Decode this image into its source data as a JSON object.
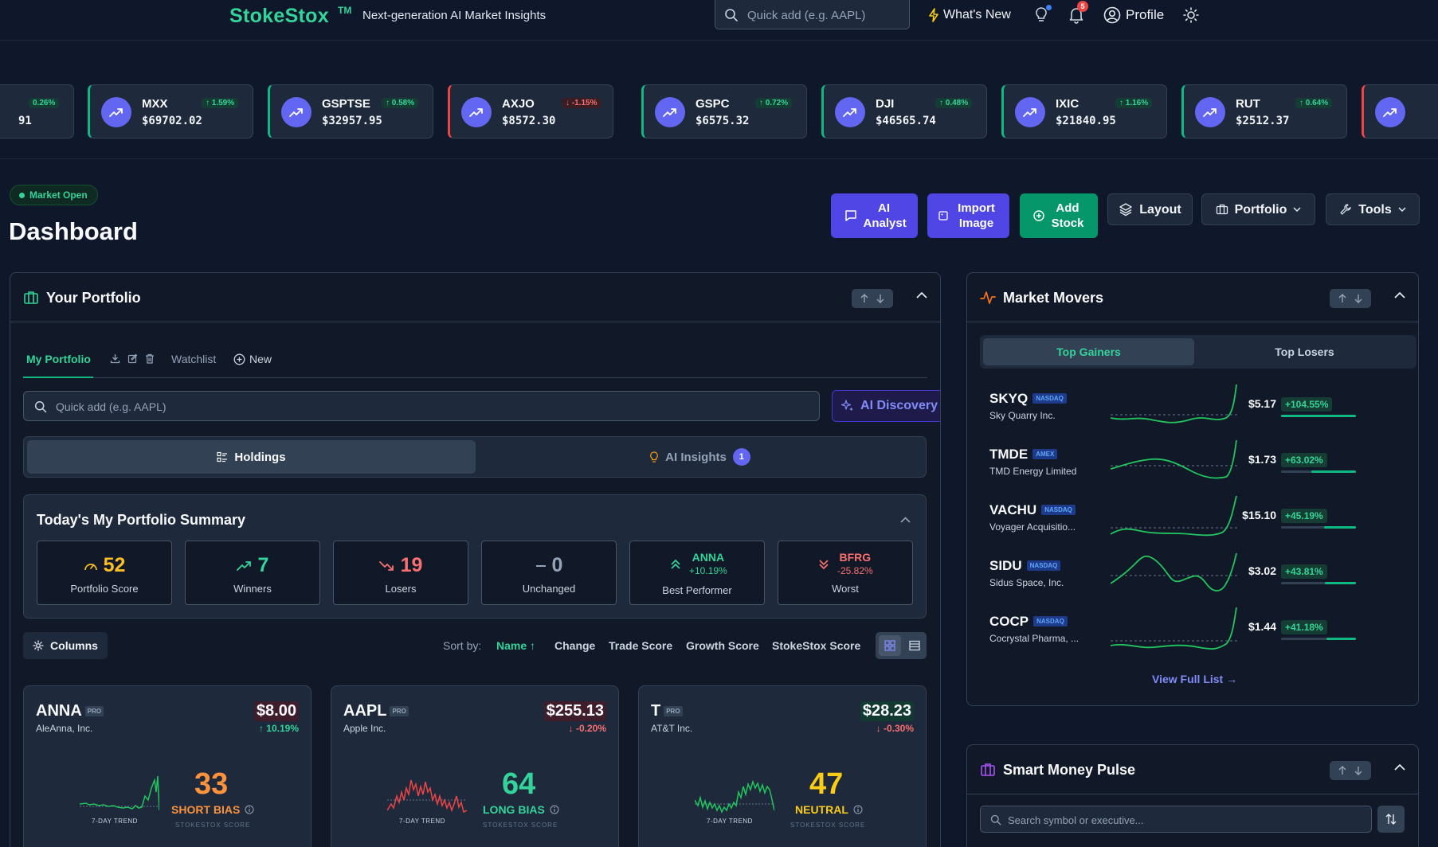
{
  "colors": {
    "accent_green": "#34d399",
    "indigo": "#4f46e5",
    "danger": "#f87171",
    "orange": "#fb923c",
    "yellow": "#facc15",
    "bg": "#0f172a"
  },
  "topbar": {
    "brand": "StokeStox",
    "tm": "TM",
    "tagline": "Next-generation AI Market Insights",
    "search_placeholder": "Quick add (e.g. AAPL)",
    "whats_new": "What's New",
    "notification_count": "5",
    "profile": "Profile"
  },
  "ticker": [
    {
      "symbol": "",
      "price": "91",
      "change": "0.26%",
      "dir": "up"
    },
    {
      "symbol": "MXX",
      "price": "$69702.02",
      "change": "1.59%",
      "dir": "up"
    },
    {
      "symbol": "GSPTSE",
      "price": "$32957.95",
      "change": "0.58%",
      "dir": "up"
    },
    {
      "symbol": "AXJO",
      "price": "$8572.30",
      "change": "-1.15%",
      "dir": "down"
    },
    {
      "symbol": "GSPC",
      "price": "$6575.32",
      "change": "0.72%",
      "dir": "up"
    },
    {
      "symbol": "DJI",
      "price": "$46565.74",
      "change": "0.48%",
      "dir": "up"
    },
    {
      "symbol": "IXIC",
      "price": "$21840.95",
      "change": "1.16%",
      "dir": "up"
    },
    {
      "symbol": "RUT",
      "price": "$2512.37",
      "change": "0.64%",
      "dir": "up"
    }
  ],
  "header": {
    "market_status": "Market Open",
    "title": "Dashboard",
    "buttons": {
      "ai_analyst": "AI Analyst",
      "import_image": "Import Image",
      "add_stock": "Add Stock",
      "layout": "Layout",
      "portfolio": "Portfolio",
      "tools": "Tools"
    }
  },
  "portfolio": {
    "title": "Your Portfolio",
    "tabs": {
      "my_portfolio": "My Portfolio",
      "watchlist": "Watchlist",
      "new": "New"
    },
    "quick_add_placeholder": "Quick add (e.g. AAPL)",
    "ai_discovery": "AI Discovery",
    "segments": {
      "holdings": "Holdings",
      "ai_insights": "AI Insights",
      "ai_insights_count": "1"
    },
    "summary": {
      "title": "Today's My Portfolio Summary",
      "portfolio_score": {
        "value": "52",
        "label": "Portfolio Score"
      },
      "winners": {
        "value": "7",
        "label": "Winners"
      },
      "losers": {
        "value": "19",
        "label": "Losers"
      },
      "unchanged": {
        "value": "0",
        "label": "Unchanged"
      },
      "best": {
        "symbol": "ANNA",
        "change": "+10.19%",
        "label": "Best Performer"
      },
      "worst": {
        "symbol": "BFRG",
        "change": "-25.82%",
        "label": "Worst"
      }
    },
    "columns_label": "Columns",
    "sort": {
      "label": "Sort by:",
      "options": [
        "Name",
        "Change",
        "Trade Score",
        "Growth Score",
        "StokeStox Score"
      ],
      "active": "Name"
    },
    "cards": [
      {
        "symbol": "ANNA",
        "pro": "PRO",
        "name": "AleAnna, Inc.",
        "price": "$8.00",
        "change": "10.19%",
        "dir": "up",
        "score": "33",
        "bias": "SHORT BIAS",
        "trend_label": "7-DAY TREND",
        "score_label": "STOKESTOX SCORE"
      },
      {
        "symbol": "AAPL",
        "pro": "PRO",
        "name": "Apple Inc.",
        "price": "$255.13",
        "change": "-0.20%",
        "dir": "down",
        "score": "64",
        "bias": "LONG BIAS",
        "trend_label": "7-DAY TREND",
        "score_label": "STOKESTOX SCORE"
      },
      {
        "symbol": "T",
        "pro": "PRO",
        "name": "AT&T Inc.",
        "price": "$28.23",
        "change": "-0.30%",
        "dir": "down",
        "score": "47",
        "bias": "NEUTRAL",
        "trend_label": "7-DAY TREND",
        "score_label": "STOKESTOX SCORE"
      }
    ]
  },
  "market_movers": {
    "title": "Market Movers",
    "tabs": {
      "gainers": "Top Gainers",
      "losers": "Top Losers"
    },
    "items": [
      {
        "symbol": "SKYQ",
        "exchange": "NASDAQ",
        "name": "Sky Quarry Inc.",
        "price": "$5.17",
        "change": "+104.55%",
        "bar": 1.0
      },
      {
        "symbol": "TMDE",
        "exchange": "AMEX",
        "name": "TMD Energy Limited",
        "price": "$1.73",
        "change": "+63.02%",
        "bar": 0.6
      },
      {
        "symbol": "VACHU",
        "exchange": "NASDAQ",
        "name": "Voyager Acquisitio...",
        "price": "$15.10",
        "change": "+45.19%",
        "bar": 0.43
      },
      {
        "symbol": "SIDU",
        "exchange": "NASDAQ",
        "name": "Sidus Space, Inc.",
        "price": "$3.02",
        "change": "+43.81%",
        "bar": 0.42
      },
      {
        "symbol": "COCP",
        "exchange": "NASDAQ",
        "name": "Cocrystal Pharma, ...",
        "price": "$1.44",
        "change": "+41.18%",
        "bar": 0.39
      }
    ],
    "view_full": "View Full List →"
  },
  "smart_money": {
    "title": "Smart Money Pulse",
    "search_placeholder": "Search symbol or executive..."
  }
}
